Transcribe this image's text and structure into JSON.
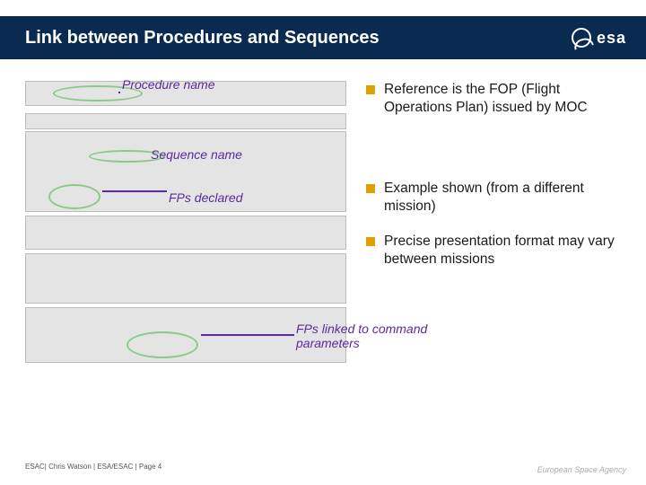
{
  "title": "Link between Procedures and Sequences",
  "logo_text": "esa",
  "annotations": {
    "proc_name": "Procedure name",
    "seq_name": "Sequence name",
    "fps_declared": "FPs declared",
    "fps_linked": "FPs linked to command parameters"
  },
  "bullets": [
    "Reference is the FOP (Flight Operations Plan) issued by MOC",
    "Example shown (from a different mission)",
    "Precise presentation format may vary between missions"
  ],
  "footer": "ESAC| Chris Watson | ESA/ESAC | Page 4",
  "footer_logo": "European Space Agency"
}
